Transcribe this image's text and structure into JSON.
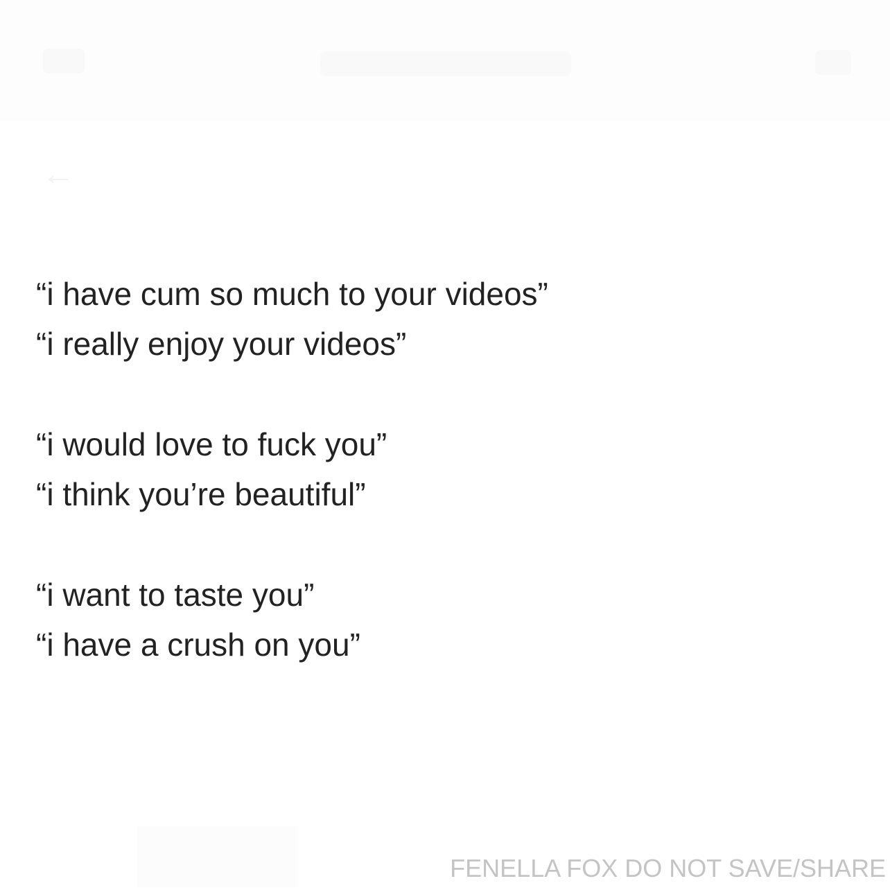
{
  "messages": [
    "“i have cum so much to your videos”",
    "“i really enjoy your videos”",
    "“i would love to fuck you”",
    "“i think you’re beautiful”",
    "“i want to taste you”",
    "“i have a crush on you”"
  ],
  "watermark": "FENELLA FOX DO NOT SAVE/SHARE",
  "colors": {
    "background": "#ffffff",
    "text": "#222222",
    "watermark": "#c4c4c4"
  }
}
